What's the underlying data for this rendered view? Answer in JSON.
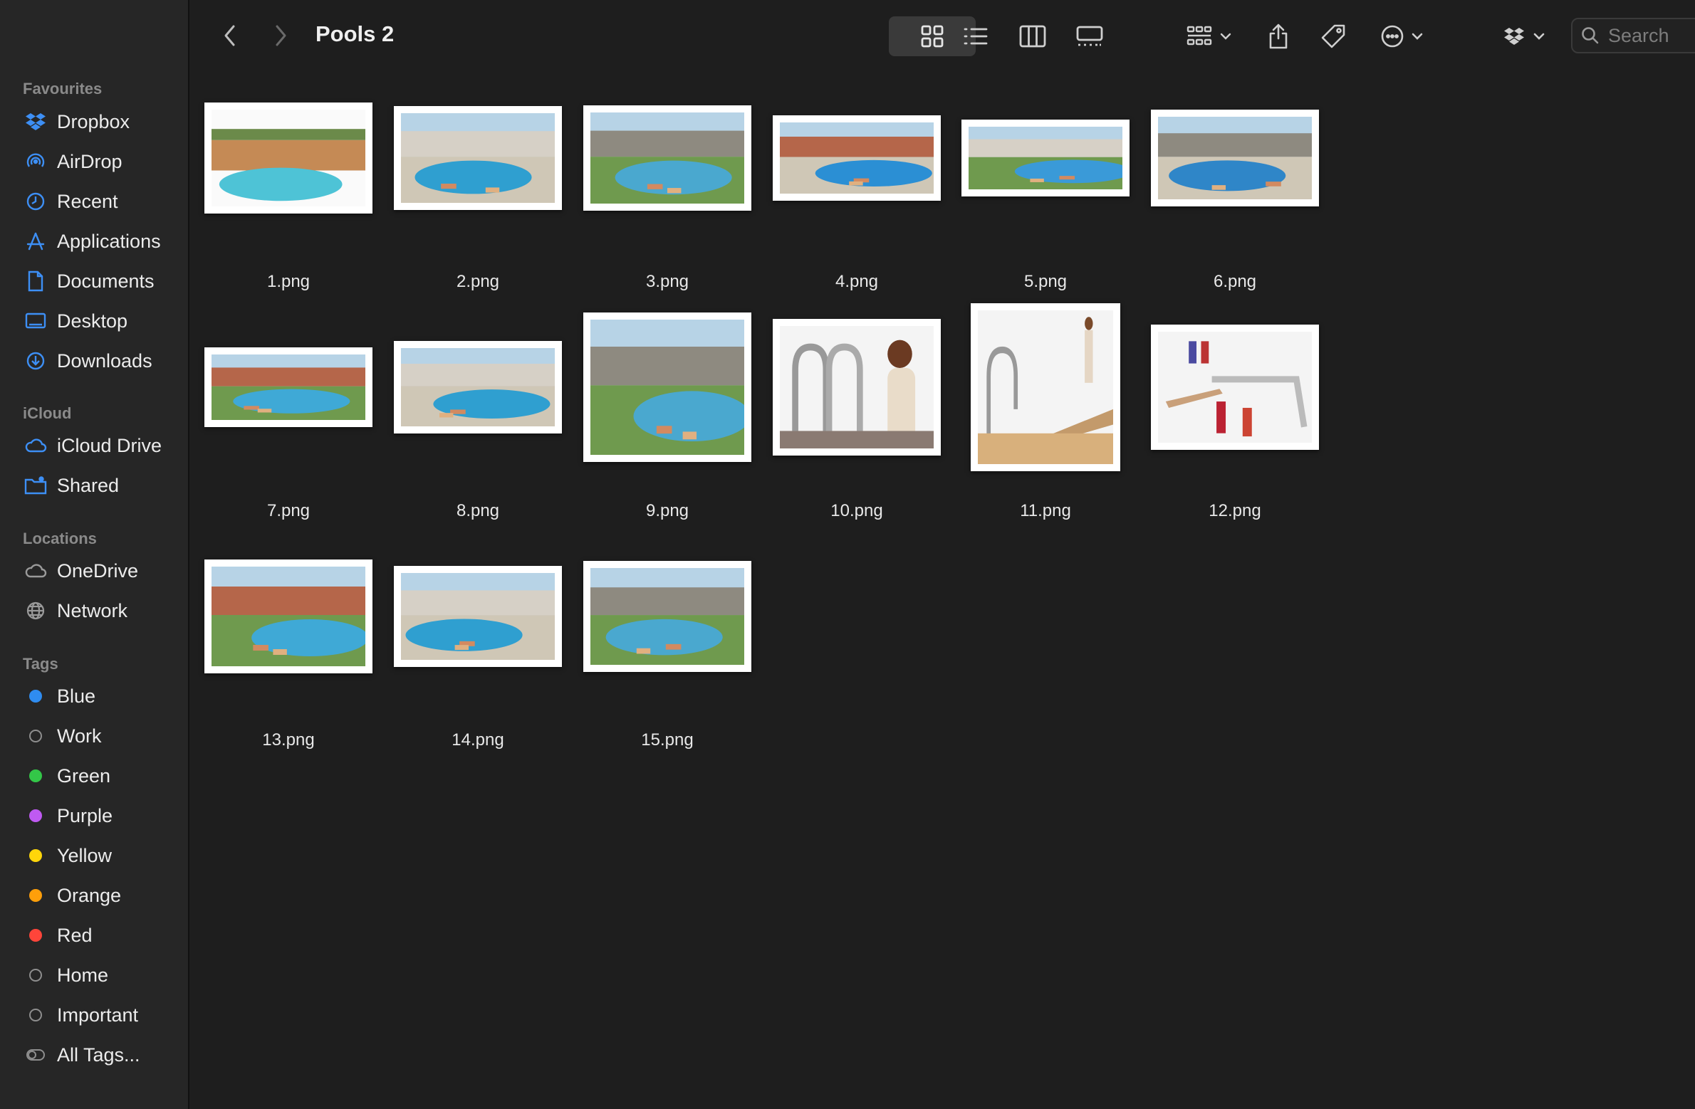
{
  "window": {
    "title": "Pools 2"
  },
  "toolbar": {
    "back_icon": "chevron-left-icon",
    "forward_icon": "chevron-right-icon",
    "view_icons": [
      "grid-view-icon",
      "list-view-icon",
      "column-view-icon",
      "gallery-view-icon"
    ],
    "search_placeholder": "Search"
  },
  "sidebar": {
    "favourites_title": "Favourites",
    "favourites": [
      {
        "label": "Dropbox",
        "icon": "dropbox-icon"
      },
      {
        "label": "AirDrop",
        "icon": "airdrop-icon"
      },
      {
        "label": "Recent",
        "icon": "clock-icon"
      },
      {
        "label": "Applications",
        "icon": "applications-icon"
      },
      {
        "label": "Documents",
        "icon": "document-icon"
      },
      {
        "label": "Desktop",
        "icon": "desktop-icon"
      },
      {
        "label": "Downloads",
        "icon": "download-icon"
      }
    ],
    "icloud_title": "iCloud",
    "icloud": [
      {
        "label": "iCloud Drive",
        "icon": "cloud-icon"
      },
      {
        "label": "Shared",
        "icon": "shared-folder-icon"
      }
    ],
    "locations_title": "Locations",
    "locations": [
      {
        "label": "OneDrive",
        "icon": "cloud-icon"
      },
      {
        "label": "Network",
        "icon": "globe-icon"
      }
    ],
    "tags_title": "Tags",
    "tags": [
      {
        "label": "Blue",
        "color": "#2f8cf0"
      },
      {
        "label": "Work",
        "color": ""
      },
      {
        "label": "Green",
        "color": "#33c748"
      },
      {
        "label": "Purple",
        "color": "#bf5af2"
      },
      {
        "label": "Yellow",
        "color": "#ffd60a"
      },
      {
        "label": "Orange",
        "color": "#ff9f0a"
      },
      {
        "label": "Red",
        "color": "#ff453a"
      },
      {
        "label": "Home",
        "color": ""
      },
      {
        "label": "Important",
        "color": ""
      },
      {
        "label": "All Tags...",
        "color": ""
      }
    ]
  },
  "files": [
    {
      "name": "1.png"
    },
    {
      "name": "2.png"
    },
    {
      "name": "3.png"
    },
    {
      "name": "4.png"
    },
    {
      "name": "5.png"
    },
    {
      "name": "6.png"
    },
    {
      "name": "7.png"
    },
    {
      "name": "8.png"
    },
    {
      "name": "9.png"
    },
    {
      "name": "10.png"
    },
    {
      "name": "11.png"
    },
    {
      "name": "12.png"
    },
    {
      "name": "13.png"
    },
    {
      "name": "14.png"
    },
    {
      "name": "15.png"
    }
  ]
}
